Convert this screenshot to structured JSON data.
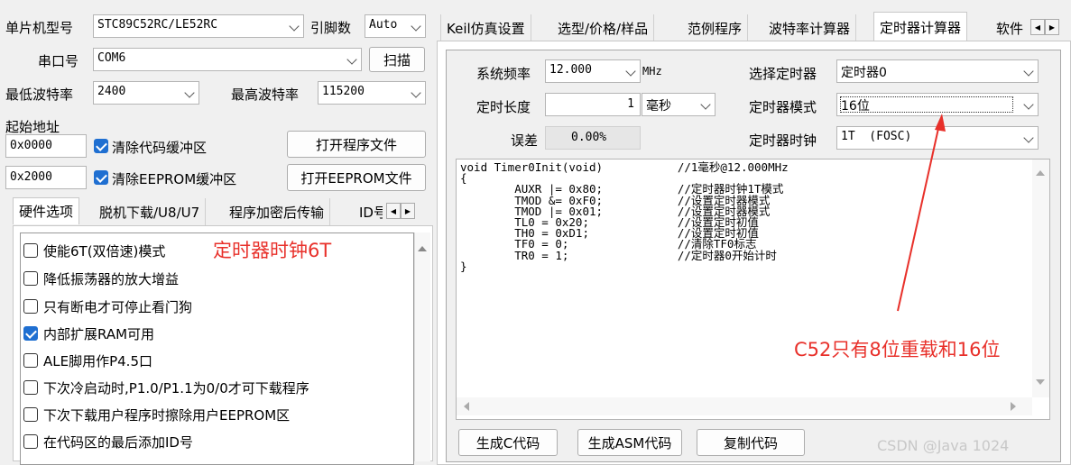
{
  "left": {
    "mcu_label": "单片机型号",
    "mcu_value": "STC89C52RC/LE52RC",
    "pin_label": "引脚数",
    "pin_value": "Auto",
    "port_label": "串口号",
    "port_value": "COM6",
    "scan_button": "扫描",
    "min_baud_label": "最低波特率",
    "min_baud_value": "2400",
    "max_baud_label": "最高波特率",
    "max_baud_value": "115200",
    "start_addr_label": "起始地址",
    "addr1_value": "0x0000",
    "clear_code_label": "清除代码缓冲区",
    "open_prog_button": "打开程序文件",
    "addr2_value": "0x2000",
    "clear_eeprom_label": "清除EEPROM缓冲区",
    "open_eeprom_button": "打开EEPROM文件",
    "tabs": [
      "硬件选项",
      "脱机下载/U8/U7",
      "程序加密后传输",
      "ID号"
    ],
    "options": [
      {
        "label": "使能6T(双倍速)模式",
        "checked": false
      },
      {
        "label": "降低振荡器的放大增益",
        "checked": false
      },
      {
        "label": "只有断电才可停止看门狗",
        "checked": false
      },
      {
        "label": "内部扩展RAM可用",
        "checked": true
      },
      {
        "label": "ALE脚用作P4.5口",
        "checked": false
      },
      {
        "label": "下次冷启动时,P1.0/P1.1为0/0才可下载程序",
        "checked": false
      },
      {
        "label": "下次下载用户程序时擦除用户EEPROM区",
        "checked": false
      },
      {
        "label": "在代码区的最后添加ID号",
        "checked": false
      }
    ]
  },
  "right": {
    "tabs": [
      "Keil仿真设置",
      "选型/价格/样品",
      "范例程序",
      "波特率计算器",
      "定时器计算器",
      "软件"
    ],
    "active_tab": "定时器计算器",
    "sys_freq_label": "系统频率",
    "sys_freq_value": "12.000",
    "sys_freq_unit": "MHz",
    "select_timer_label": "选择定时器",
    "select_timer_value": "定时器0",
    "timer_len_label": "定时长度",
    "timer_len_value": "1",
    "timer_len_unit": "毫秒",
    "timer_mode_label": "定时器模式",
    "timer_mode_value": "16位",
    "error_label": "误差",
    "error_value": "0.00%",
    "timer_clock_label": "定时器时钟",
    "timer_clock_value": "1T  (FOSC)",
    "code": "void Timer0Init(void)           //1毫秒@12.000MHz\n{\n        AUXR |= 0x80;           //定时器时钟1T模式\n        TMOD &= 0xF0;           //设置定时器模式\n        TMOD |= 0x01;           //设置定时器模式\n        TL0 = 0x20;             //设置定时初值\n        TH0 = 0xD1;             //设置定时初值\n        TF0 = 0;                //清除TF0标志\n        TR0 = 1;                //定时器0开始计时\n}",
    "gen_c_button": "生成C代码",
    "gen_asm_button": "生成ASM代码",
    "copy_button": "复制代码"
  },
  "annotations": {
    "clock_6t": "定时器时钟6T",
    "c52_note": "C52只有8位重载和16位",
    "arrow_color": "#e8302a"
  },
  "watermark": "CSDN @Java 1024"
}
